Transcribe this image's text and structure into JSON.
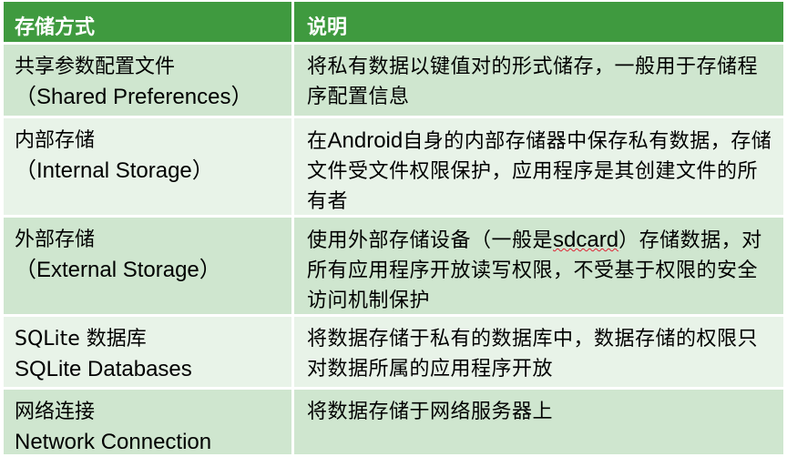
{
  "table": {
    "headers": [
      "存储方式",
      "说明"
    ],
    "rows": [
      {
        "name_line1": "共享参数配置文件",
        "name_line2": "（Shared Preferences）",
        "desc": "将私有数据以键值对的形式储存，一般用于存储程序配置信息"
      },
      {
        "name_line1": "内部存储",
        "name_line2": "（Internal Storage）",
        "desc_prefix": "在",
        "desc_latin": "Android",
        "desc_suffix": "自身的内部存储器中保存私有数据，存储文件受文件权限保护，应用程序是其创建文件的所有者"
      },
      {
        "name_line1": "外部存储",
        "name_line2": "（External Storage）",
        "desc_prefix": "使用外部存储设备（一般是",
        "desc_latin": "sdcard",
        "desc_suffix": "）存储数据，对所有应用程序开放读写权限，不受基于权限的安全访问机制保护"
      },
      {
        "name_line1": "SQLite 数据库",
        "name_line2": "SQLite Databases",
        "desc": "将数据存储于私有的数据库中，数据存储的权限只对数据所属的应用程序开放"
      },
      {
        "name_line1": "网络连接",
        "name_line2": "Network Connection",
        "desc": "将数据存储于网络服务器上"
      }
    ]
  },
  "colors": {
    "header_bg": "#3f9a3f",
    "row_odd_bg": "#cfe6cf",
    "row_even_bg": "#e8f3e8"
  }
}
